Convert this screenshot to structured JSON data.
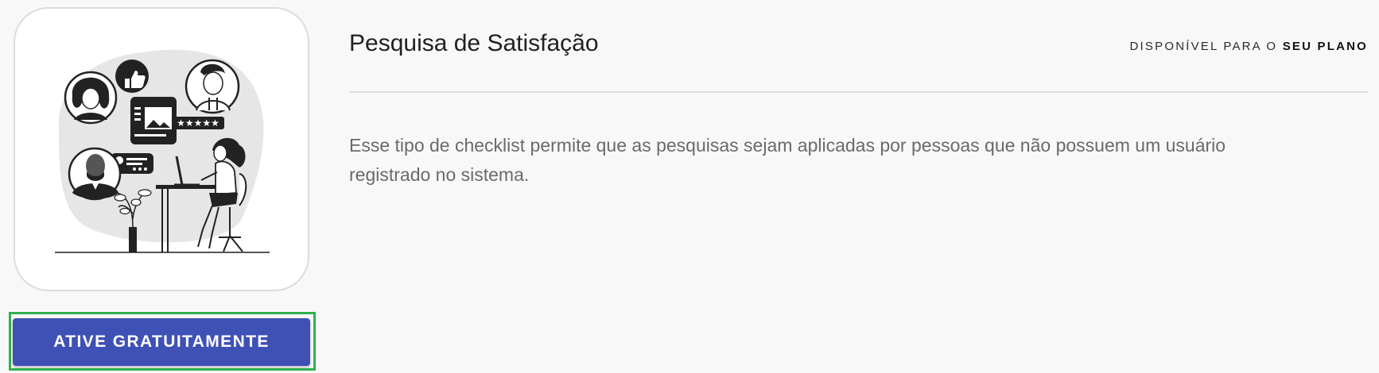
{
  "card": {
    "title": "Pesquisa de Satisfação",
    "availability_prefix": "DISPONÍVEL PARA O",
    "availability_plan": "SEU PLANO",
    "description": "Esse tipo de checklist permite que as pesquisas sejam aplicadas por pessoas que não possuem um usuário registrado no sistema.",
    "illustration": "customer-feedback-illustration",
    "stars": "★★★★★"
  },
  "actions": {
    "activate_label": "ATIVE GRATUITAMENTE"
  },
  "colors": {
    "primary_button": "#3f51b5",
    "highlight_outline": "#2eb14d",
    "page_background": "#f8f8f8"
  }
}
